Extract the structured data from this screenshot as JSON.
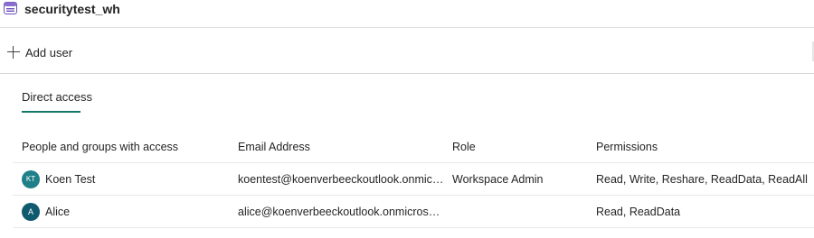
{
  "header": {
    "title": "securitytest_wh",
    "icon": "warehouse-icon"
  },
  "toolbar": {
    "add_user_label": "Add user",
    "add_icon": "plus-icon"
  },
  "tabs": [
    {
      "label": "Direct access",
      "selected": true
    }
  ],
  "accent_color": "#117865",
  "table": {
    "columns": [
      "People and groups with access",
      "Email Address",
      "Role",
      "Permissions"
    ],
    "rows": [
      {
        "initials": "KT",
        "avatar_color": "#20808a",
        "name": "Koen Test",
        "email": "koentest@koenverbeeckoutlook.onmicrosof...",
        "role": "Workspace Admin",
        "permissions": "Read, Write, Reshare, ReadData, ReadAll"
      },
      {
        "initials": "A",
        "avatar_color": "#0f5a6e",
        "name": "Alice",
        "email": "alice@koenverbeeckoutlook.onmicrosoft.com",
        "role": "",
        "permissions": "Read, ReadData"
      }
    ]
  }
}
